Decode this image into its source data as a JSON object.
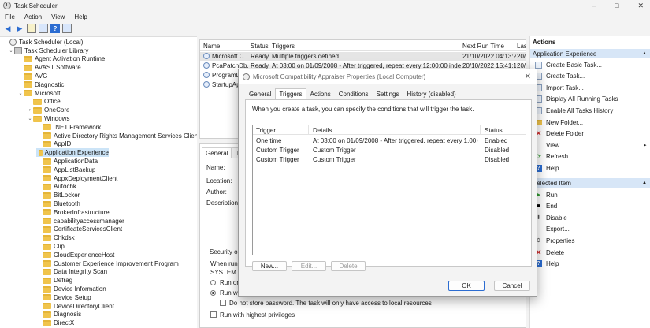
{
  "window": {
    "title": "Task Scheduler",
    "controls": [
      "–",
      "□",
      "✕"
    ]
  },
  "menu": [
    "File",
    "Action",
    "View",
    "Help"
  ],
  "toolbar": {
    "icons": [
      "back-arrow-icon",
      "forward-arrow-icon",
      "folder-up-icon",
      "properties-icon",
      "help-icon",
      "show-pane-icon"
    ]
  },
  "tree": {
    "items": [
      {
        "label": "Task Scheduler (Local)",
        "level": 0,
        "icon": "clock",
        "exp": ""
      },
      {
        "label": "Task Scheduler Library",
        "level": 1,
        "icon": "lib",
        "exp": "v"
      },
      {
        "label": "Agent Activation Runtime",
        "level": 2,
        "icon": "folder",
        "exp": ""
      },
      {
        "label": "AVAST Software",
        "level": 2,
        "icon": "folder",
        "exp": ""
      },
      {
        "label": "AVG",
        "level": 2,
        "icon": "folder",
        "exp": ""
      },
      {
        "label": "Diagnostic",
        "level": 2,
        "icon": "folder",
        "exp": ""
      },
      {
        "label": "Microsoft",
        "level": 2,
        "icon": "folder",
        "exp": "v"
      },
      {
        "label": "Office",
        "level": 3,
        "icon": "folder",
        "exp": ""
      },
      {
        "label": "OneCore",
        "level": 3,
        "icon": "folder",
        "exp": ">"
      },
      {
        "label": "Windows",
        "level": 3,
        "icon": "folder",
        "exp": "v"
      },
      {
        "label": ".NET Framework",
        "level": 4,
        "icon": "folder",
        "exp": ""
      },
      {
        "label": "Active Directory Rights Management Services Client",
        "level": 4,
        "icon": "folder",
        "exp": ""
      },
      {
        "label": "AppID",
        "level": 4,
        "icon": "folder",
        "exp": ""
      },
      {
        "label": "Application Experience",
        "level": 4,
        "icon": "folder",
        "exp": "",
        "selected": true
      },
      {
        "label": "ApplicationData",
        "level": 4,
        "icon": "folder",
        "exp": ""
      },
      {
        "label": "AppListBackup",
        "level": 4,
        "icon": "folder",
        "exp": ""
      },
      {
        "label": "AppxDeploymentClient",
        "level": 4,
        "icon": "folder",
        "exp": ""
      },
      {
        "label": "Autochk",
        "level": 4,
        "icon": "folder",
        "exp": ""
      },
      {
        "label": "BitLocker",
        "level": 4,
        "icon": "folder",
        "exp": ""
      },
      {
        "label": "Bluetooth",
        "level": 4,
        "icon": "folder",
        "exp": ""
      },
      {
        "label": "BrokerInfrastructure",
        "level": 4,
        "icon": "folder",
        "exp": ""
      },
      {
        "label": "capabilityaccessmanager",
        "level": 4,
        "icon": "folder",
        "exp": ""
      },
      {
        "label": "CertificateServicesClient",
        "level": 4,
        "icon": "folder",
        "exp": ""
      },
      {
        "label": "Chkdsk",
        "level": 4,
        "icon": "folder",
        "exp": ""
      },
      {
        "label": "Clip",
        "level": 4,
        "icon": "folder",
        "exp": ""
      },
      {
        "label": "CloudExperienceHost",
        "level": 4,
        "icon": "folder",
        "exp": ""
      },
      {
        "label": "Customer Experience Improvement Program",
        "level": 4,
        "icon": "folder",
        "exp": ""
      },
      {
        "label": "Data Integrity Scan",
        "level": 4,
        "icon": "folder",
        "exp": ""
      },
      {
        "label": "Defrag",
        "level": 4,
        "icon": "folder",
        "exp": ""
      },
      {
        "label": "Device Information",
        "level": 4,
        "icon": "folder",
        "exp": ""
      },
      {
        "label": "Device Setup",
        "level": 4,
        "icon": "folder",
        "exp": ""
      },
      {
        "label": "DeviceDirectoryClient",
        "level": 4,
        "icon": "folder",
        "exp": ""
      },
      {
        "label": "Diagnosis",
        "level": 4,
        "icon": "folder",
        "exp": ""
      },
      {
        "label": "DirectX",
        "level": 4,
        "icon": "folder",
        "exp": ""
      }
    ]
  },
  "tasklist": {
    "headers": [
      "Name",
      "Status",
      "Triggers",
      "Next Run Time",
      "Las"
    ],
    "rows": [
      {
        "name": "Microsoft C...",
        "status": "Ready",
        "triggers": "Multiple triggers defined",
        "next": "21/10/2022 04:13:23",
        "last": "20/"
      },
      {
        "name": "PcaPatchDb...",
        "status": "Ready",
        "triggers": "At 03:00 on 01/09/2008 - After triggered, repeat every 12:00:00 indefinitely.",
        "next": "20/10/2022 15:41:13",
        "last": "20/"
      },
      {
        "name": "ProgramDa",
        "status": "",
        "triggers": "",
        "next": "",
        "last": ""
      },
      {
        "name": "StartupApp",
        "status": "",
        "triggers": "",
        "next": "",
        "last": ""
      }
    ]
  },
  "general": {
    "tabs": [
      "General",
      "Trig"
    ],
    "labels": {
      "name": "Name:",
      "location": "Location:",
      "author": "Author:",
      "description": "Description:",
      "security": "Security opt",
      "when": "When runn",
      "system": "SYSTEM",
      "run_only": "Run onl",
      "run_whether": "Run wh",
      "no_store": "Do not store password.  The task will only have access to local resources",
      "highest": "Run with highest privileges"
    }
  },
  "actions": {
    "title": "Actions",
    "section1": "Application Experience",
    "items1": [
      {
        "label": "Create Basic Task...",
        "icon": "doc"
      },
      {
        "label": "Create Task...",
        "icon": "doc"
      },
      {
        "label": "Import Task...",
        "icon": "doc"
      },
      {
        "label": "Display All Running Tasks",
        "icon": "doc"
      },
      {
        "label": "Enable All Tasks History",
        "icon": "doc"
      },
      {
        "label": "New Folder...",
        "icon": "folder"
      },
      {
        "label": "Delete Folder",
        "icon": "red"
      },
      {
        "label": "View",
        "icon": "none",
        "submenu": true
      },
      {
        "label": "Refresh",
        "icon": "green"
      },
      {
        "label": "Help",
        "icon": "help"
      }
    ],
    "section2": "Selected Item",
    "items2": [
      {
        "label": "Run",
        "icon": "play"
      },
      {
        "label": "End",
        "icon": "stop"
      },
      {
        "label": "Disable",
        "icon": "dis"
      },
      {
        "label": "Export...",
        "icon": "none"
      },
      {
        "label": "Properties",
        "icon": "gear"
      },
      {
        "label": "Delete",
        "icon": "red"
      },
      {
        "label": "Help",
        "icon": "help"
      }
    ]
  },
  "dialog": {
    "title": "Microsoft Compatibility Appraiser Properties (Local Computer)",
    "tabs": [
      "General",
      "Triggers",
      "Actions",
      "Conditions",
      "Settings",
      "History (disabled)"
    ],
    "active_tab": "Triggers",
    "description": "When you create a task, you can specify the conditions that will trigger the task.",
    "columns": [
      "Trigger",
      "Details",
      "Status"
    ],
    "rows": [
      {
        "trigger": "One time",
        "details": "At 03:00 on 01/09/2008 - After triggered, repeat every 1.00:00:00 i...",
        "status": "Enabled"
      },
      {
        "trigger": "Custom Trigger",
        "details": "Custom Trigger",
        "status": "Disabled"
      },
      {
        "trigger": "Custom Trigger",
        "details": "Custom Trigger",
        "status": "Disabled"
      }
    ],
    "buttons": {
      "new": "New...",
      "edit": "Edit...",
      "delete": "Delete",
      "ok": "OK",
      "cancel": "Cancel"
    }
  }
}
